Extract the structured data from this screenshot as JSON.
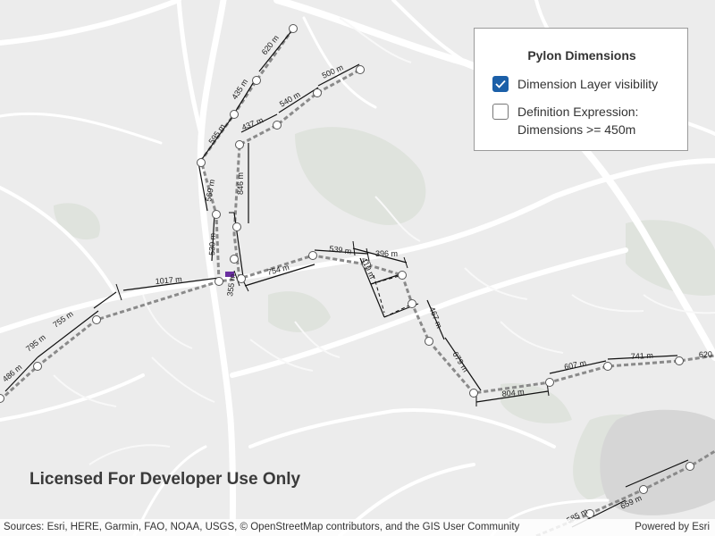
{
  "panel": {
    "title": "Pylon Dimensions",
    "options": [
      {
        "label": "Dimension Layer visibility",
        "checked": true
      },
      {
        "label_line1": "Definition Expression:",
        "label_line2": "Dimensions >= 450m",
        "checked": false
      }
    ]
  },
  "watermark": "Licensed For Developer Use Only",
  "attribution": {
    "sources": "Sources: Esri, HERE, Garmin, FAO, NOAA, USGS, © OpenStreetMap contributors, and the GIS User Community",
    "powered_by": "Powered by Esri"
  },
  "dimension_labels": [
    "620 m",
    "435 m",
    "500 m",
    "540 m",
    "437 m",
    "595 m",
    "846 m",
    "569 m",
    "530 m",
    "539 m",
    "396 m",
    "410 m",
    "1017 m",
    "754 m",
    "355 m",
    "755 m",
    "795 m",
    "486 m",
    "467 m",
    "679 m",
    "804 m",
    "607 m",
    "741 m",
    "620",
    "659 m",
    "585 m"
  ],
  "colors": {
    "map_background": "#ececec",
    "road": "#ffffff",
    "dimension_line": "#111111",
    "power_line": "#8a8a8a",
    "checkbox_checked": "#1b5fa8"
  }
}
